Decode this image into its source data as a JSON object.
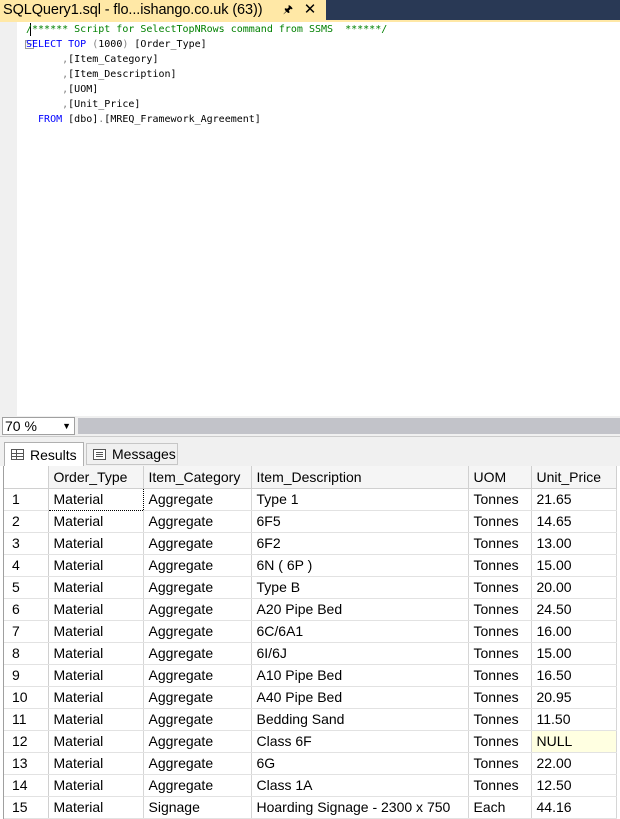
{
  "tab": {
    "title": "SQLQuery1.sql - flo...ishango.co.uk (63))",
    "pin_icon": "pin-icon",
    "close_icon": "close-icon"
  },
  "editor": {
    "lines": [
      {
        "parts": [
          {
            "t": "/****** Script for SelectTopNRows command from SSMS  ******/",
            "c": "cm"
          }
        ]
      },
      {
        "parts": [
          {
            "t": "SELECT TOP ",
            "c": "kw"
          },
          {
            "t": "(",
            "c": "gr"
          },
          {
            "t": "1000",
            "c": ""
          },
          {
            "t": ")",
            "c": "gr"
          },
          {
            "t": " [Order_Type]",
            "c": ""
          }
        ]
      },
      {
        "parts": [
          {
            "t": "      ",
            "c": ""
          },
          {
            "t": ",",
            "c": "gr"
          },
          {
            "t": "[Item_Category]",
            "c": ""
          }
        ]
      },
      {
        "parts": [
          {
            "t": "      ",
            "c": ""
          },
          {
            "t": ",",
            "c": "gr"
          },
          {
            "t": "[Item_Description]",
            "c": ""
          }
        ]
      },
      {
        "parts": [
          {
            "t": "      ",
            "c": ""
          },
          {
            "t": ",",
            "c": "gr"
          },
          {
            "t": "[UOM]",
            "c": ""
          }
        ]
      },
      {
        "parts": [
          {
            "t": "      ",
            "c": ""
          },
          {
            "t": ",",
            "c": "gr"
          },
          {
            "t": "[Unit_Price]",
            "c": ""
          }
        ]
      },
      {
        "parts": [
          {
            "t": "  FROM ",
            "c": "kw"
          },
          {
            "t": "[dbo]",
            "c": ""
          },
          {
            "t": ".",
            "c": "gr"
          },
          {
            "t": "[MREQ_Framework_Agreement]",
            "c": ""
          }
        ]
      }
    ]
  },
  "zoom": {
    "value": "70 %"
  },
  "results_tabs": {
    "results_label": "Results",
    "messages_label": "Messages"
  },
  "grid": {
    "columns": [
      "Order_Type",
      "Item_Category",
      "Item_Description",
      "UOM",
      "Unit_Price"
    ],
    "rows": [
      [
        "1",
        "Material",
        "Aggregate",
        "Type 1",
        "Tonnes",
        "21.65"
      ],
      [
        "2",
        "Material",
        "Aggregate",
        "6F5",
        "Tonnes",
        "14.65"
      ],
      [
        "3",
        "Material",
        "Aggregate",
        "6F2",
        "Tonnes",
        "13.00"
      ],
      [
        "4",
        "Material",
        "Aggregate",
        "6N ( 6P )",
        "Tonnes",
        "15.00"
      ],
      [
        "5",
        "Material",
        "Aggregate",
        "Type B",
        "Tonnes",
        "20.00"
      ],
      [
        "6",
        "Material",
        "Aggregate",
        "A20 Pipe Bed",
        "Tonnes",
        "24.50"
      ],
      [
        "7",
        "Material",
        "Aggregate",
        "6C/6A1",
        "Tonnes",
        "16.00"
      ],
      [
        "8",
        "Material",
        "Aggregate",
        "6I/6J",
        "Tonnes",
        "15.00"
      ],
      [
        "9",
        "Material",
        "Aggregate",
        "A10 Pipe Bed",
        "Tonnes",
        "16.50"
      ],
      [
        "10",
        "Material",
        "Aggregate",
        "A40 Pipe Bed",
        "Tonnes",
        "20.95"
      ],
      [
        "11",
        "Material",
        "Aggregate",
        "Bedding Sand",
        "Tonnes",
        "11.50"
      ],
      [
        "12",
        "Material",
        "Aggregate",
        "Class 6F",
        "Tonnes",
        "NULL"
      ],
      [
        "13",
        "Material",
        "Aggregate",
        "6G",
        "Tonnes",
        "22.00"
      ],
      [
        "14",
        "Material",
        "Aggregate",
        "Class 1A",
        "Tonnes",
        "12.50"
      ],
      [
        "15",
        "Material",
        "Signage",
        "Hoarding Signage - 2300 x 750",
        "Each",
        "44.16"
      ]
    ]
  }
}
